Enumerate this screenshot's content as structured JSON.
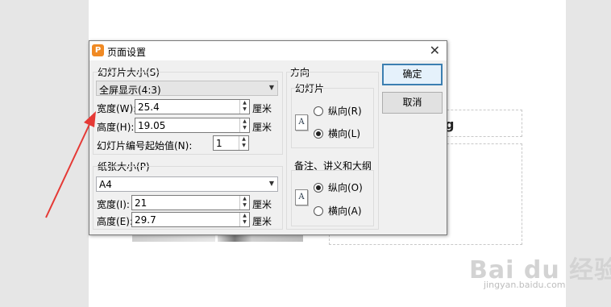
{
  "dialog": {
    "title": "页面设置",
    "ok_label": "确定",
    "cancel_label": "取消"
  },
  "slide_size": {
    "group_title": "幻灯片大小(S)",
    "selected": "全屏显示(4:3)",
    "width_label": "宽度(W):",
    "width_value": "25.4",
    "height_label": "高度(H):",
    "height_value": "19.05",
    "unit": "厘米",
    "numbering_label": "幻灯片编号起始值(N):",
    "numbering_value": "1"
  },
  "paper_size": {
    "group_title": "纸张大小(P)",
    "selected": "A4",
    "width_label": "宽度(I):",
    "width_value": "21",
    "height_label": "高度(E):",
    "height_value": "29.7",
    "unit": "厘米"
  },
  "orientation": {
    "title": "方向",
    "slides_title": "幻灯片",
    "slides_portrait": "纵向(R)",
    "slides_landscape": "横向(L)",
    "slides_selected": "landscape",
    "notes_title": "备注、讲义和大纲",
    "notes_portrait": "纵向(O)",
    "notes_landscape": "横向(A)",
    "notes_selected": "portrait",
    "icon_letter": "A"
  },
  "background": {
    "glyph": "g",
    "watermark_logo": "Bai du 经验",
    "watermark_url": "jingyan.baidu.com"
  },
  "colors": {
    "accent": "#3c7fb1",
    "arrow": "#e53935",
    "app_icon": "#f08a24"
  }
}
